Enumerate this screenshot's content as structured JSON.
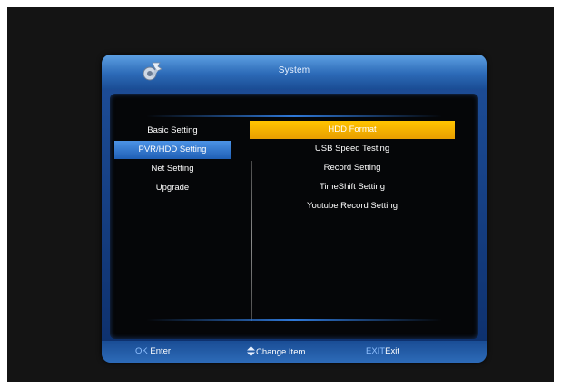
{
  "header": {
    "title": "System",
    "icon": "settings-wrench-icon"
  },
  "left_menu": {
    "items": [
      {
        "label": "Basic Setting",
        "active": false
      },
      {
        "label": "PVR/HDD Setting",
        "active": true
      },
      {
        "label": "Net Setting",
        "active": false
      },
      {
        "label": "Upgrade",
        "active": false
      }
    ]
  },
  "right_menu": {
    "items": [
      {
        "label": "HDD Format",
        "active": true
      },
      {
        "label": "USB Speed Testing",
        "active": false
      },
      {
        "label": "Record Setting",
        "active": false
      },
      {
        "label": "TimeShift Setting",
        "active": false
      },
      {
        "label": "Youtube Record Setting",
        "active": false
      }
    ]
  },
  "footer": {
    "ok_key": "OK",
    "ok_label": "Enter",
    "change_icon": "up-down-arrows-icon",
    "change_label": "Change Item",
    "exit_key": "EXIT",
    "exit_label": "Exit"
  },
  "colors": {
    "header_blue": "#2d6bb8",
    "highlight_orange": "#f5b200",
    "selected_blue": "#3b80d6",
    "background": "#141414"
  }
}
